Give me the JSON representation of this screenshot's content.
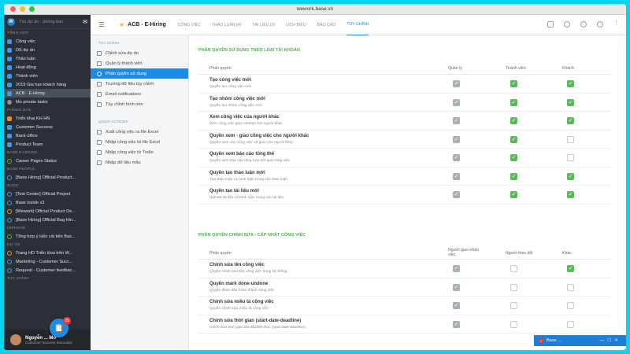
{
  "window": {
    "url": "wework.base.vn"
  },
  "sidebar": {
    "search_placeholder": "Tìm dự án · phòng ban",
    "sections": [
      {
        "title": "TỔNG HỢP",
        "items": [
          {
            "label": "Công việc",
            "icon": "blue"
          },
          {
            "label": "DS dự án",
            "icon": "blue"
          },
          {
            "label": "Thảo luận",
            "icon": "blue"
          },
          {
            "label": "Hoạt động",
            "icon": "blue"
          },
          {
            "label": "Thành viên",
            "icon": "blue"
          },
          {
            "label": "2019 Gia hạn khách hàng",
            "icon": "blue"
          },
          {
            "label": "ACB - E-Hiring",
            "icon": "blue",
            "active": true
          },
          {
            "label": "Mo private tasks",
            "icon": "dot"
          }
        ]
      },
      {
        "title": "PHÒNG BAN",
        "items": [
          {
            "label": "Triển khai KH HN",
            "icon": "orange"
          },
          {
            "label": "Customer Success",
            "icon": "blue"
          },
          {
            "label": "Back-office",
            "icon": "blue"
          },
          {
            "label": "Product Team",
            "icon": "blue"
          }
        ]
      },
      {
        "title": "BASE E-HIRING",
        "items": [
          {
            "label": "Career Pages Status",
            "icon": "ring green"
          }
        ]
      },
      {
        "title": "BASE PEOPLE",
        "items": [
          {
            "label": "[Base Hiring] Official Product...",
            "icon": "ring"
          }
        ]
      },
      {
        "title": "BUGS",
        "items": [
          {
            "label": "[Test Center] Official Project",
            "icon": "ring"
          },
          {
            "label": "Base inside v3",
            "icon": "ring"
          },
          {
            "label": "[Wework] Official Product De...",
            "icon": "ring orange"
          },
          {
            "label": "[Base Hiring] Official Bug Hin...",
            "icon": "ring"
          }
        ]
      },
      {
        "title": "IMPROVE",
        "items": [
          {
            "label": "Tổng hợp ý kiến cải tiến Bas...",
            "icon": "ring green"
          }
        ]
      },
      {
        "title": "DỰ ÁN",
        "items": [
          {
            "label": "Trang HD Triển khai trên W...",
            "icon": "ring orange"
          },
          {
            "label": "Marketing - Customer Succ...",
            "icon": "ring"
          },
          {
            "label": "Request - Customer feedbac...",
            "icon": "ring"
          }
        ]
      },
      {
        "title": "TÙY CHỈNH",
        "items": []
      }
    ],
    "user": {
      "name": "Nguyễn ... Mơ",
      "role": "Customer Success Executive"
    },
    "fab_badge": "29"
  },
  "header": {
    "title": "ACB - E-Hiring",
    "tabs": [
      {
        "label": "CÔNG VIỆC"
      },
      {
        "label": "THẢO LUẬN (4)"
      },
      {
        "label": "TÀI LIỆU (0)"
      },
      {
        "label": "LỊCH BIỂU"
      },
      {
        "label": "BÁO CÁO"
      },
      {
        "label": "TÙY CHỈNH",
        "active": true
      }
    ]
  },
  "subnav": {
    "section1": "TÙY CHỈNH",
    "items1": [
      {
        "label": "Chỉnh sửa dự án"
      },
      {
        "label": "Quản lý thành viên"
      },
      {
        "label": "Phân quyền sử dụng",
        "active": true
      },
      {
        "label": "Trường dữ liệu tùy chỉnh"
      },
      {
        "label": "Email notifications"
      },
      {
        "label": "Tùy chỉnh hình nền"
      }
    ],
    "section2": "QUICK ACTIONS",
    "items2": [
      {
        "label": "Xuất công việc ra file Excel"
      },
      {
        "label": "Nhập công việc từ file Excel"
      },
      {
        "label": "Nhập công việc từ Trello"
      },
      {
        "label": "Nhập dữ liệu mẫu"
      }
    ]
  },
  "section1": {
    "title": "PHÂN QUYỀN SỬ DỤNG THEO LOẠI TÀI KHOẢN",
    "headers": [
      "Phân quyền",
      "Quản lý",
      "Thành viên",
      "Khách"
    ],
    "rows": [
      {
        "title": "Tạo công việc mới",
        "sub": "Quyền tạo công việc mới",
        "checks": [
          "grey",
          "green",
          "green"
        ]
      },
      {
        "title": "Tạo nhóm công việc mới",
        "sub": "Quyền tạo nhóm công việc mới",
        "checks": [
          "grey",
          "green",
          "green"
        ]
      },
      {
        "title": "Xem công việc của người khác",
        "sub": "Xem công việc giao cho/tạo bởi người khác",
        "checks": [
          "grey",
          "green",
          "green"
        ]
      },
      {
        "title": "Quyền xem - giao công việc cho người khác",
        "sub": "Quyền xem các công việc và giao cho người khác",
        "checks": [
          "grey",
          "green",
          "empty"
        ]
      },
      {
        "title": "Quyền xem báo cáo tổng thể",
        "sub": "Quyền xem báo cáo tổng hợp kết quả công việc",
        "checks": [
          "grey",
          "green",
          "empty"
        ]
      },
      {
        "title": "Quyền tạo thảo luận mới",
        "sub": "Tạo thảo luận và bình luận trong các thảo luận",
        "checks": [
          "grey",
          "green",
          "green"
        ]
      },
      {
        "title": "Quyền tạo tài liệu mới",
        "sub": "Upload tài liệu và bình luận trong các tài liệu",
        "checks": [
          "grey",
          "green",
          "green"
        ]
      }
    ]
  },
  "section2": {
    "title": "PHÂN QUYỀN CHỈNH SỬA - CẬP NHẬT CÔNG VIỆC",
    "headers": [
      "Phân quyền",
      "Người giao-nhận việc",
      "Người theo dõi",
      "Khác"
    ],
    "rows": [
      {
        "title": "Chỉnh sửa tên công việc",
        "sub": "Quyền chỉnh sửa tên công việc trong hệ thống",
        "checks": [
          "grey",
          "empty",
          "green"
        ]
      },
      {
        "title": "Quyền mark done-undone",
        "sub": "Quyền đánh dấu hoàn thành công việc",
        "checks": [
          "grey",
          "empty",
          "empty"
        ]
      },
      {
        "title": "Chỉnh sửa miêu tả công việc",
        "sub": "Quyền chỉnh sửa miêu tả công việc",
        "checks": [
          "grey",
          "empty",
          "empty"
        ]
      },
      {
        "title": "Chỉnh sửa thời gian (start-date-deadline)",
        "sub": "Chỉnh sửa thời gian bắt đầu/kết thúc (start date-deadline)",
        "checks": [
          "grey",
          "empty",
          "empty"
        ]
      }
    ]
  },
  "chat": {
    "label": "Base ...",
    "badge": "2"
  }
}
